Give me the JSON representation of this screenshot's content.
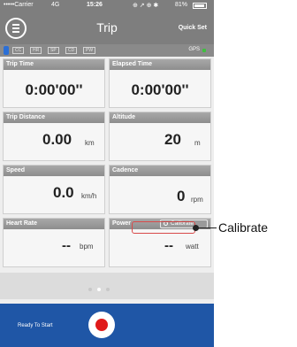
{
  "status_bar": {
    "carrier": "•••••Carrier",
    "network": "4G",
    "time": "15:26",
    "icons": "⊕ ↗ ⊕ ✱",
    "battery": "81%"
  },
  "nav": {
    "title": "Trip",
    "quick_set": "Quick Set",
    "menu_icon": "menu-icon"
  },
  "sensors": {
    "chips": [
      "CC",
      "HR",
      "SP",
      "CD",
      "PW"
    ],
    "gps_label": "GPS",
    "gps_color": "#3fbf3f",
    "bluetooth_color": "#2b6fd6"
  },
  "fields": {
    "trip_time": {
      "label": "Trip Time",
      "value": "0:00'00''"
    },
    "elapsed_time": {
      "label": "Elapsed Time",
      "value": "0:00'00''"
    },
    "trip_distance": {
      "label": "Trip Distance",
      "value": "0.00",
      "unit": "km"
    },
    "altitude": {
      "label": "Altitude",
      "value": "20",
      "unit": "m"
    },
    "speed": {
      "label": "Speed",
      "value": "0.0",
      "unit": "km/h"
    },
    "cadence": {
      "label": "Cadence",
      "value": "0",
      "unit": "rpm"
    },
    "heart_rate": {
      "label": "Heart Rate",
      "value": "--",
      "unit": "bpm"
    },
    "power": {
      "label": "Power",
      "value": "--",
      "unit": "watt",
      "calibrate_button": "Calibrate"
    }
  },
  "pager": {
    "count": 3,
    "active": 1
  },
  "bottom": {
    "status": "Ready To Start",
    "record_color": "#e01a1a",
    "bar_color": "#1f56a6"
  },
  "callout": {
    "label": "Calibrate",
    "highlight_color": "#d84a4a"
  }
}
